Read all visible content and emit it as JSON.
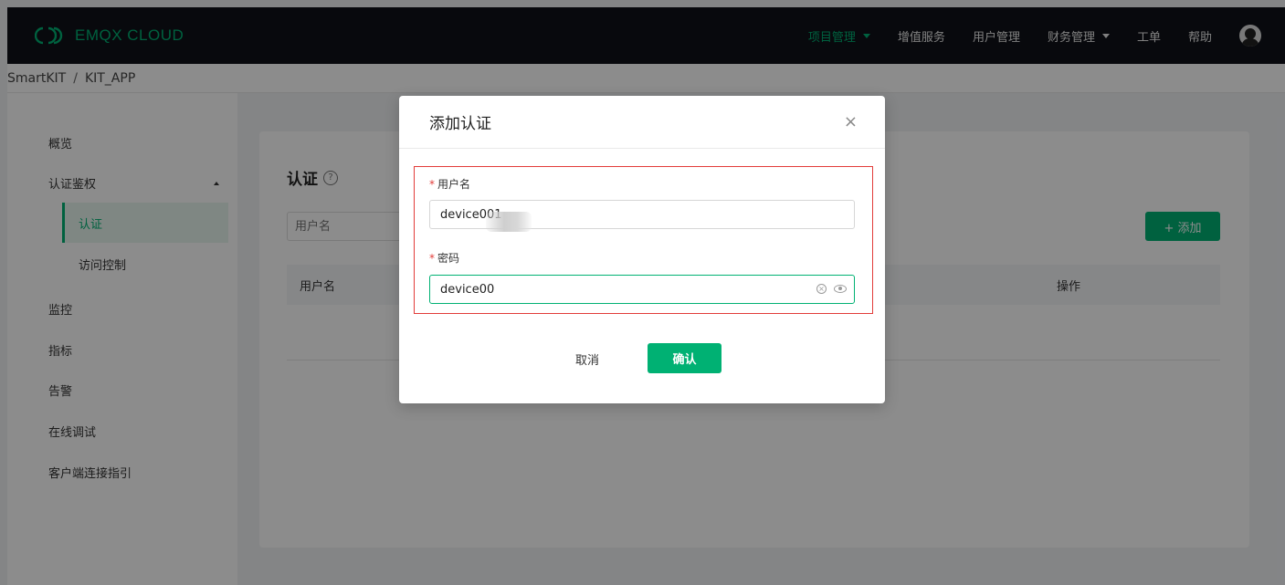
{
  "brand": {
    "name": "EMQX CLOUD",
    "accent": "#00b173"
  },
  "nav": {
    "items": [
      {
        "label": "项目管理",
        "dropdown": true,
        "active": true
      },
      {
        "label": "增值服务",
        "dropdown": false,
        "active": false
      },
      {
        "label": "用户管理",
        "dropdown": false,
        "active": false
      },
      {
        "label": "财务管理",
        "dropdown": true,
        "active": false
      },
      {
        "label": "工单",
        "dropdown": false,
        "active": false
      },
      {
        "label": "帮助",
        "dropdown": false,
        "active": false
      }
    ],
    "avatar_icon": "user-avatar-icon"
  },
  "breadcrumb": {
    "project": "SmartKIT",
    "separator": "/",
    "deployment": "KIT_APP"
  },
  "sidebar": {
    "items": [
      {
        "label": "概览"
      },
      {
        "label": "认证鉴权",
        "expanded": true
      },
      {
        "label": "认证",
        "sub": true,
        "active": true
      },
      {
        "label": "访问控制",
        "sub": true
      },
      {
        "label": "监控"
      },
      {
        "label": "指标"
      },
      {
        "label": "告警"
      },
      {
        "label": "在线调试"
      },
      {
        "label": "客户端连接指引"
      }
    ]
  },
  "main": {
    "title": "认证",
    "help_icon": "question-circle-icon",
    "filter_placeholder": "用户名",
    "add_button": "+ 添加",
    "table": {
      "headers": [
        "用户名",
        "操作"
      ]
    }
  },
  "modal": {
    "title": "添加认证",
    "close": "×",
    "fields": {
      "username": {
        "label": "用户名",
        "required": "*",
        "value": "device001"
      },
      "password": {
        "label": "密码",
        "required": "*",
        "value": "device00"
      }
    },
    "cancel": "取消",
    "confirm": "确认"
  }
}
